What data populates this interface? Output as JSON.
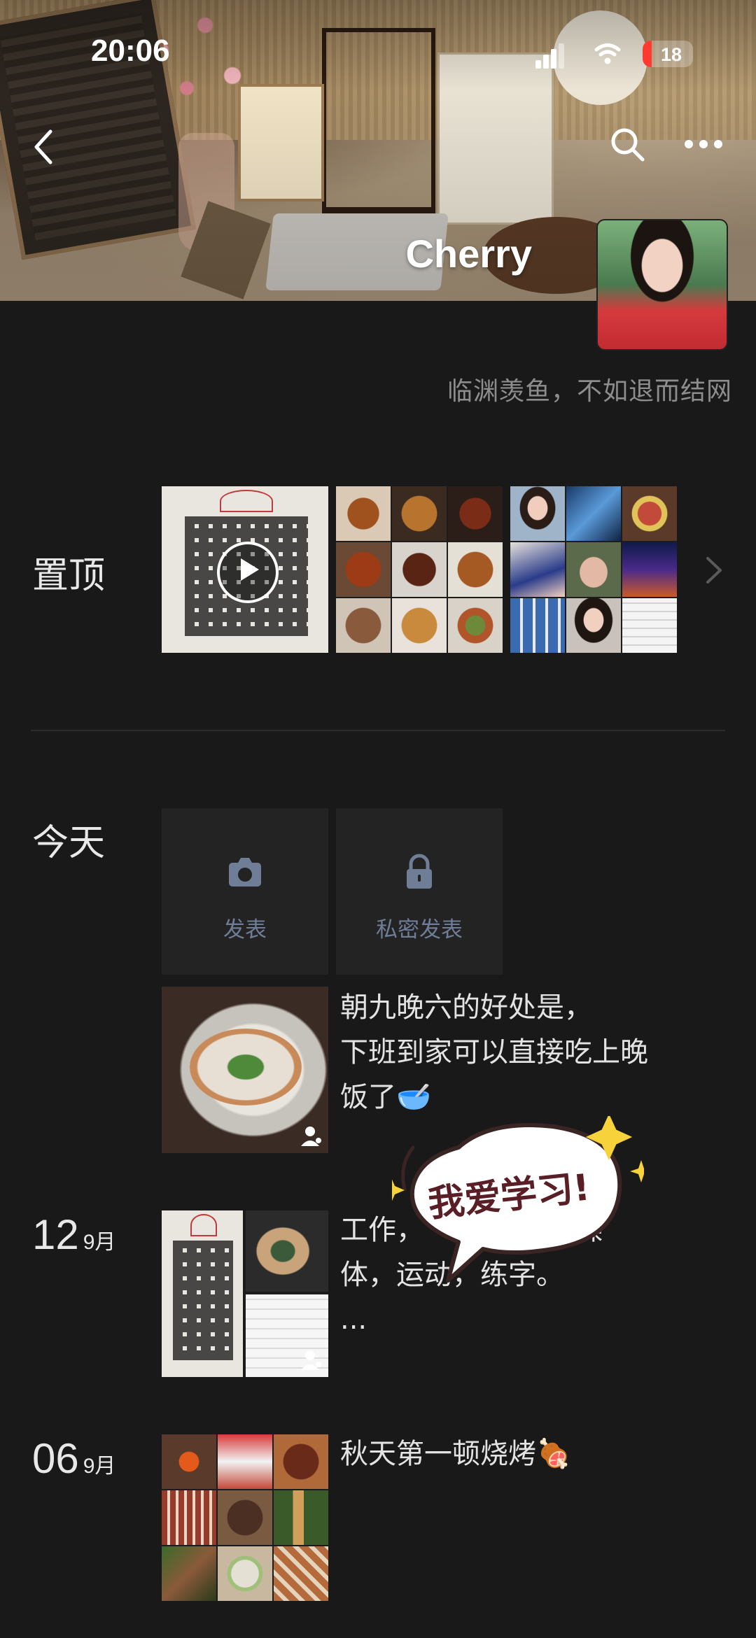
{
  "status_bar": {
    "time": "20:06",
    "battery": "18"
  },
  "profile": {
    "name": "Cherry",
    "bio": "临渊羡鱼，不如退而结网"
  },
  "pinned": {
    "label": "置顶"
  },
  "today": {
    "label": "今天",
    "post_button": "发表",
    "private_post_button": "私密发表",
    "post_text_lines": [
      "朝九晚六的好处是，",
      "下班到家可以直接吃上晚",
      "饭了🥣"
    ]
  },
  "entries": [
    {
      "day": "12",
      "month": "9月",
      "text_lines": [
        "工作，",
        "媒",
        "体，运",
        "动，练字。",
        "..."
      ]
    },
    {
      "day": "06",
      "month": "9月",
      "text": "秋天第一顿烧烤🍖"
    }
  ],
  "sticker": {
    "text": "我爱学习!"
  },
  "icons": {
    "back": "back-arrow-icon",
    "search": "search-icon",
    "more": "more-dots-icon",
    "camera": "camera-icon",
    "lock": "lock-icon",
    "chevron": "chevron-right-icon",
    "play": "play-icon",
    "visibility": "partial-visible-icon"
  },
  "colors": {
    "background": "#191919",
    "accent_label": "#6f7e96",
    "battery_low": "#ff3b30"
  }
}
